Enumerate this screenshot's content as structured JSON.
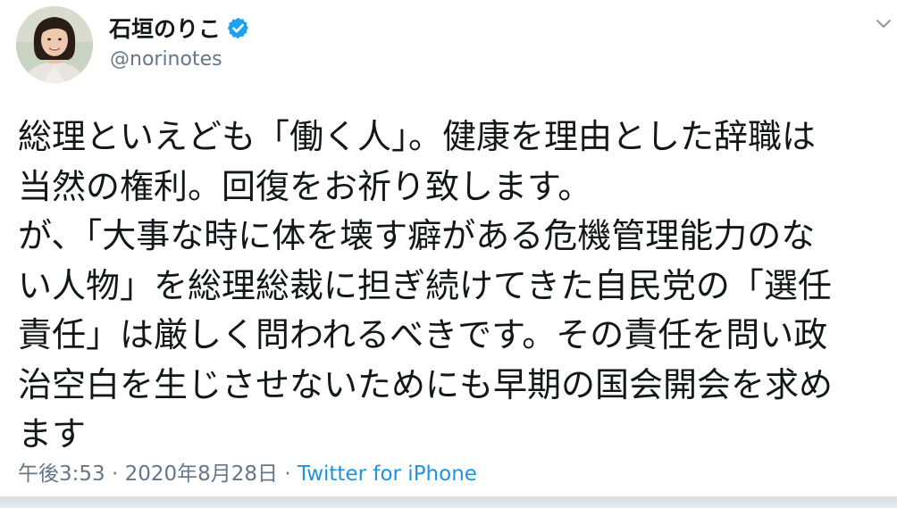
{
  "user": {
    "display_name": "石垣のりこ",
    "handle": "@norinotes",
    "verified": true
  },
  "tweet": {
    "lines": [
      "総理といえども「働く人」。健康を理由とした辞職は",
      "当然の権利。回復をお祈り致します。",
      "が、「大事な時に体を壊す癖がある危機管理能力のな",
      "い人物」を総理総裁に担ぎ続けてきた自民党の「選任",
      "責任」は厳しく問われるべきです。その責任を問い政",
      "治空白を生じさせないためにも早期の国会開会を求め",
      "ます"
    ]
  },
  "meta": {
    "time": "午後3:53",
    "separator": "·",
    "date": "2020年8月28日",
    "source": "Twitter for iPhone"
  },
  "icons": {
    "verified": "verified-badge-icon",
    "menu": "chevron-down-icon"
  },
  "colors": {
    "text": "#14171a",
    "muted": "#657786",
    "link": "#1b95e0",
    "verified": "#1da1f2"
  }
}
